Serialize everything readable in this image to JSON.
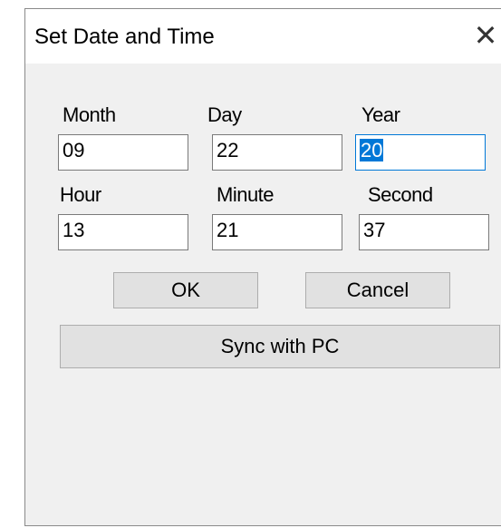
{
  "dialog": {
    "title": "Set Date and Time"
  },
  "date": {
    "month_label": "Month",
    "month_value": "09",
    "day_label": "Day",
    "day_value": "22",
    "year_label": "Year",
    "year_value": "20"
  },
  "time": {
    "hour_label": "Hour",
    "hour_value": "13",
    "minute_label": "Minute",
    "minute_value": "21",
    "second_label": "Second",
    "second_value": "37"
  },
  "buttons": {
    "ok": "OK",
    "cancel": "Cancel",
    "sync": "Sync with PC"
  },
  "colors": {
    "selection": "#0078d7",
    "dialog_bg": "#f0f0f0"
  },
  "icons": {
    "close": "close-icon"
  }
}
